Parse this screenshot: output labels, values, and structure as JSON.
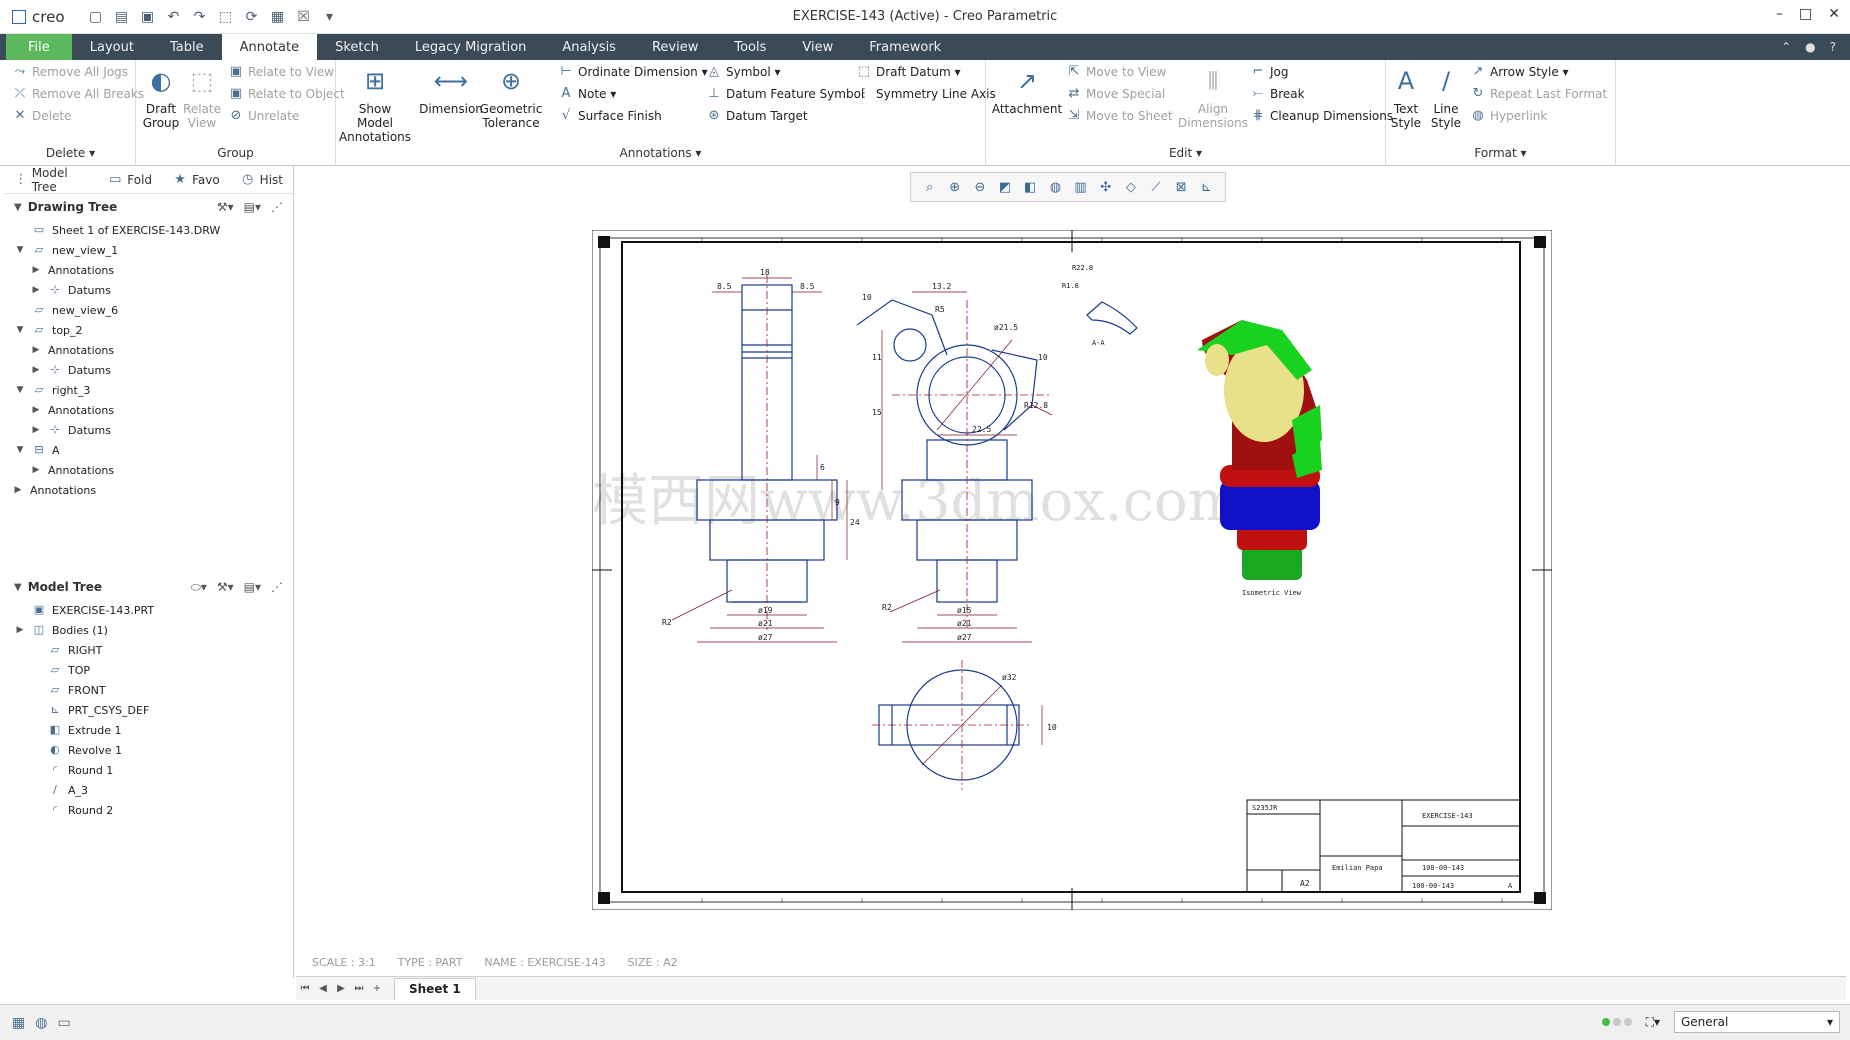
{
  "app": {
    "logo": "creo",
    "window_title": "EXERCISE-143 (Active) - Creo Parametric"
  },
  "tabs": [
    "File",
    "Layout",
    "Table",
    "Annotate",
    "Sketch",
    "Legacy Migration",
    "Analysis",
    "Review",
    "Tools",
    "View",
    "Framework"
  ],
  "active_tab": "Annotate",
  "ribbon": {
    "delete_group": {
      "label": "Delete",
      "items": [
        "Remove All Jogs",
        "Remove All Breaks",
        "Delete"
      ]
    },
    "group_group": {
      "label": "Group",
      "draft_group": "Draft Group",
      "relate_view": "Relate View",
      "items": [
        "Relate to View",
        "Relate to Object",
        "Unrelate"
      ]
    },
    "annotations_group": {
      "label": "Annotations",
      "show_model": "Show Model Annotations",
      "dimension": "Dimension",
      "geometric_tolerance": "Geometric Tolerance",
      "col1": [
        "Ordinate Dimension",
        "Note",
        "Surface Finish"
      ],
      "col2": [
        "Symbol",
        "Datum Feature Symbol",
        "Datum Target"
      ],
      "col3": [
        "Draft Datum",
        "Symmetry Line Axis"
      ]
    },
    "edit_group": {
      "label": "Edit",
      "attachment": "Attachment",
      "align_dimensions": "Align Dimensions",
      "col1": [
        "Move to View",
        "Move Special",
        "Move to Sheet"
      ],
      "col2": [
        "Jog",
        "Break",
        "Cleanup Dimensions"
      ]
    },
    "format_group": {
      "label": "Format",
      "text_style": "Text Style",
      "line_style": "Line Style",
      "items": [
        "Arrow Style",
        "Repeat Last Format",
        "Hyperlink"
      ]
    }
  },
  "left_panel": {
    "tabs": [
      "Model Tree",
      "Fold",
      "Favo",
      "Hist"
    ],
    "drawing_tree": {
      "title": "Drawing Tree",
      "items": [
        {
          "label": "Sheet 1 of EXERCISE-143.DRW",
          "indent": 0,
          "exp": "",
          "icon": "sheet-icon"
        },
        {
          "label": "new_view_1",
          "indent": 0,
          "exp": "▼",
          "icon": "view-icon"
        },
        {
          "label": "Annotations",
          "indent": 1,
          "exp": "▶",
          "icon": ""
        },
        {
          "label": "Datums",
          "indent": 1,
          "exp": "▶",
          "icon": "datum-icon"
        },
        {
          "label": "new_view_6",
          "indent": 0,
          "exp": "",
          "icon": "view-icon"
        },
        {
          "label": "top_2",
          "indent": 0,
          "exp": "▼",
          "icon": "view-icon"
        },
        {
          "label": "Annotations",
          "indent": 1,
          "exp": "▶",
          "icon": ""
        },
        {
          "label": "Datums",
          "indent": 1,
          "exp": "▶",
          "icon": "datum-icon"
        },
        {
          "label": "right_3",
          "indent": 0,
          "exp": "▼",
          "icon": "view-icon"
        },
        {
          "label": "Annotations",
          "indent": 1,
          "exp": "▶",
          "icon": ""
        },
        {
          "label": "Datums",
          "indent": 1,
          "exp": "▶",
          "icon": "datum-icon"
        },
        {
          "label": "A",
          "indent": 0,
          "exp": "▼",
          "icon": "section-icon"
        },
        {
          "label": "Annotations",
          "indent": 1,
          "exp": "▶",
          "icon": ""
        },
        {
          "label": "Annotations",
          "indent": -1,
          "exp": "▶",
          "icon": ""
        }
      ]
    },
    "model_tree": {
      "title": "Model Tree",
      "items": [
        {
          "label": "EXERCISE-143.PRT",
          "indent": 0,
          "exp": "",
          "icon": "part-icon"
        },
        {
          "label": "Bodies (1)",
          "indent": 0,
          "exp": "▶",
          "icon": "body-icon"
        },
        {
          "label": "RIGHT",
          "indent": 1,
          "exp": "",
          "icon": "plane-icon"
        },
        {
          "label": "TOP",
          "indent": 1,
          "exp": "",
          "icon": "plane-icon"
        },
        {
          "label": "FRONT",
          "indent": 1,
          "exp": "",
          "icon": "plane-icon"
        },
        {
          "label": "PRT_CSYS_DEF",
          "indent": 1,
          "exp": "",
          "icon": "csys-icon"
        },
        {
          "label": "Extrude 1",
          "indent": 1,
          "exp": "",
          "icon": "extrude-icon"
        },
        {
          "label": "Revolve 1",
          "indent": 1,
          "exp": "",
          "icon": "revolve-icon"
        },
        {
          "label": "Round 1",
          "indent": 1,
          "exp": "",
          "icon": "round-icon"
        },
        {
          "label": "A_3",
          "indent": 1,
          "exp": "",
          "icon": "axis-icon"
        },
        {
          "label": "Round 2",
          "indent": 1,
          "exp": "",
          "icon": "round-icon"
        }
      ]
    }
  },
  "drawing": {
    "watermark": "模西网www.3dmox.com",
    "iso_label": "Isometric View",
    "section_label": "A-A",
    "dims_front": [
      "18",
      "8.5",
      "8.5",
      "ø19",
      "ø21",
      "ø27",
      "R2",
      "6",
      "9",
      "24"
    ],
    "dims_right": [
      "13.2",
      "10",
      "R5",
      "ø21.5",
      "10",
      "R12.8",
      "22.5",
      "15",
      "11",
      "ø15",
      "ø21",
      "ø27",
      "R2"
    ],
    "dims_top": [
      "ø32",
      "10"
    ],
    "dims_detail": [
      "R22.8",
      "R1.8"
    ],
    "title_block": {
      "material": "S235JR",
      "name": "EXERCISE-143",
      "code1": "100-00-143",
      "code2": "100-00-143",
      "size": "A2",
      "paper": "Emilian Papa",
      "rev": "A"
    }
  },
  "status": {
    "scale": "SCALE : 3:1",
    "type": "TYPE : PART",
    "name": "NAME : EXERCISE-143",
    "size": "SIZE : A2"
  },
  "sheet_tab": "Sheet 1",
  "filter_value": "General",
  "colors": {
    "tab_bg": "#3a4a57",
    "file_tab": "#5cb85c",
    "drawing_line": "#1a3a8a",
    "dim_line": "#7a1a2a",
    "iso_green": "#19d21f",
    "iso_red": "#c01010",
    "iso_blue": "#1010c8",
    "iso_yellow": "#f4f0a0"
  }
}
